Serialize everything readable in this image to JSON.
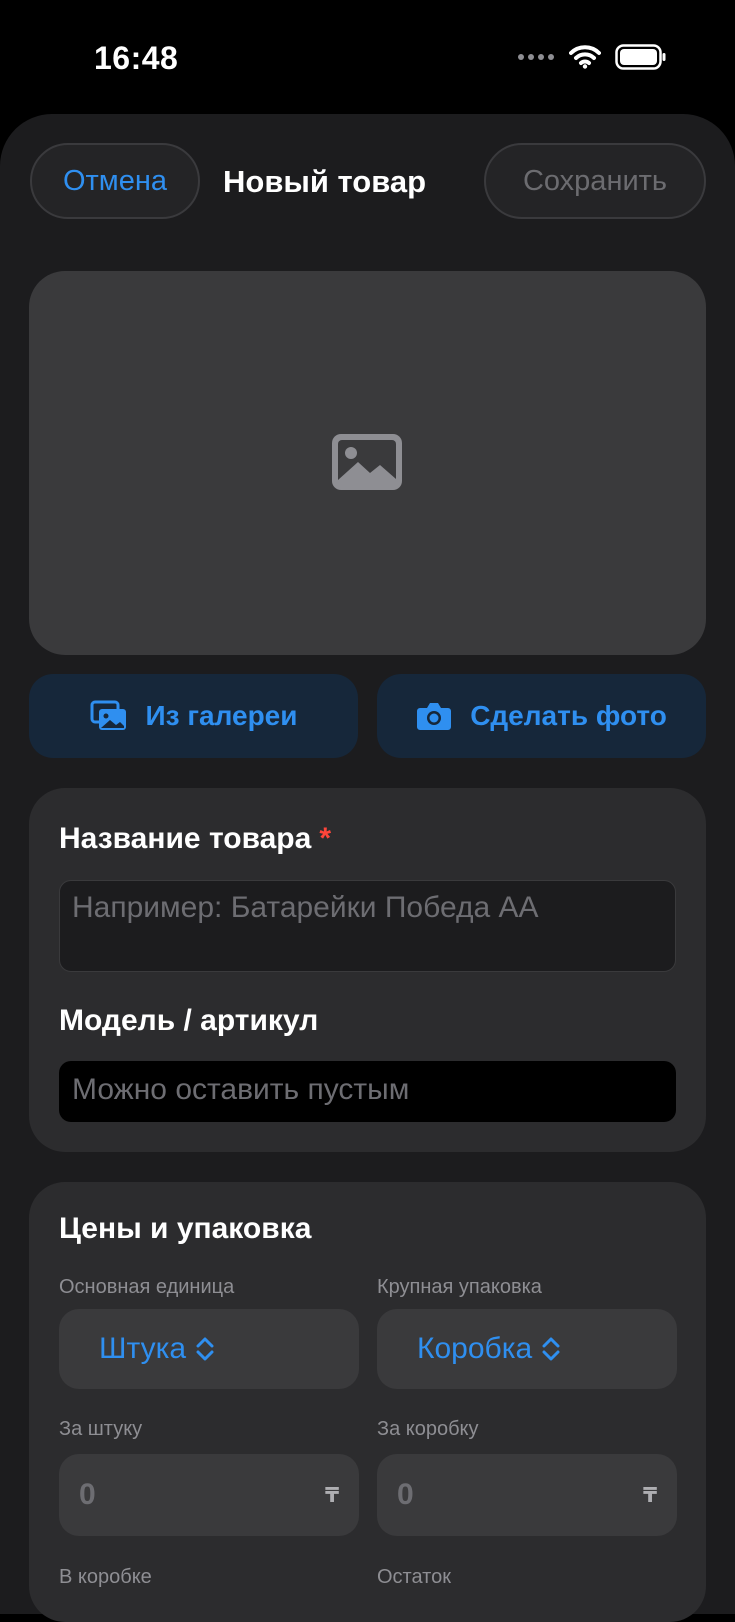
{
  "status": {
    "time": "16:48"
  },
  "nav": {
    "cancel": "Отмена",
    "title": "Новый товар",
    "save": "Сохранить"
  },
  "photo": {
    "placeholder_icon": "image-icon",
    "gallery_label": "Из галереи",
    "gallery_icon": "photo-stack-icon",
    "camera_label": "Сделать фото",
    "camera_icon": "camera-icon"
  },
  "details": {
    "name_label": "Название товара",
    "required_mark": "*",
    "name_placeholder": "Например: Батарейки Победа АА",
    "model_label": "Модель / артикул",
    "model_placeholder": "Можно оставить пустым"
  },
  "pricing": {
    "title": "Цены и упаковка",
    "base_unit_label": "Основная единица",
    "base_unit_value": "Штука",
    "pack_label": "Крупная упаковка",
    "pack_value": "Коробка",
    "per_unit_label": "За штуку",
    "per_unit_value": "0",
    "per_box_label": "За коробку",
    "per_box_value": "0",
    "currency": "₸",
    "in_box_label": "В коробке",
    "stock_label": "Остаток"
  },
  "colors": {
    "accent": "#2f8ff0",
    "required": "#ff453a",
    "background": "#1c1c1e",
    "card": "#2c2c2e"
  }
}
